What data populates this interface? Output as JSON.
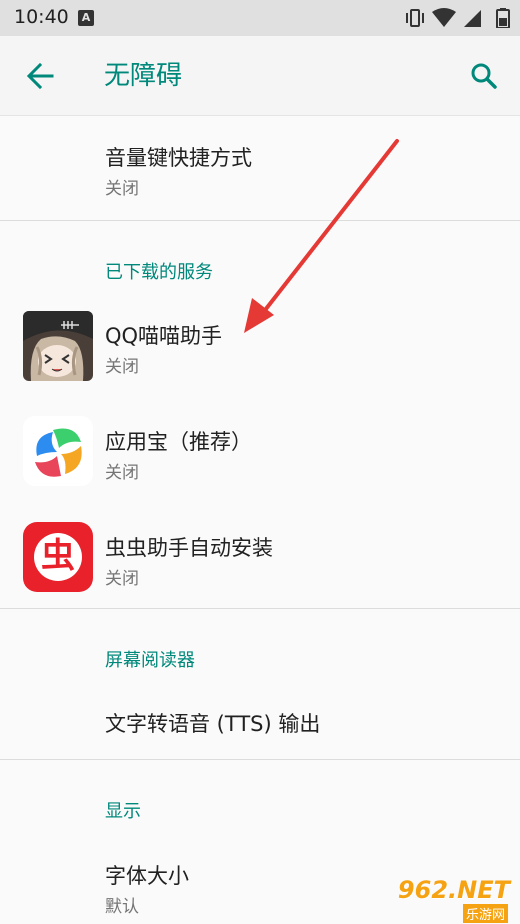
{
  "status_bar": {
    "time": "10:40",
    "a_icon": "A"
  },
  "toolbar": {
    "title": "无障碍"
  },
  "items": {
    "volume_shortcut": {
      "title": "音量键快捷方式",
      "sub": "关闭"
    },
    "qq": {
      "title": "QQ喵喵助手",
      "sub": "关闭"
    },
    "yyb": {
      "title": "应用宝（推荐）",
      "sub": "关闭"
    },
    "chong": {
      "title": "虫虫助手自动安装",
      "sub": "关闭"
    },
    "tts": {
      "title": "文字转语音 (TTS) 输出"
    },
    "font_size": {
      "title": "字体大小",
      "sub": "默认"
    }
  },
  "sections": {
    "downloaded": "已下载的服务",
    "screen_reader": "屏幕阅读器",
    "display": "显示"
  },
  "chong_glyph": "虫",
  "watermark": {
    "main": "962.NET",
    "sub": "乐游网"
  },
  "colors": {
    "accent": "#00897b",
    "arrow": "#e53935",
    "chong_red": "#e8212b"
  }
}
